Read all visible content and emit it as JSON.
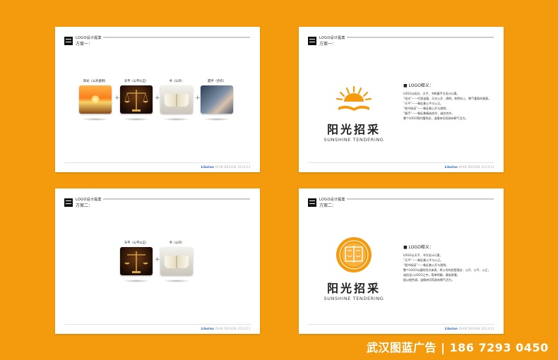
{
  "header": {
    "title": "LOGO设计提案",
    "scheme1": "方案一：",
    "scheme2": "方案二："
  },
  "footer": {
    "logo": "Libolan",
    "right_text": "DIAN DESIGN",
    "page": "2013/11"
  },
  "card1": {
    "items": [
      {
        "label": "阳光（公开透明）",
        "icon": "sunrise-image"
      },
      {
        "label": "天平（公平公正）",
        "icon": "scales-image"
      },
      {
        "label": "书（公开）",
        "icon": "open-book-image"
      },
      {
        "label": "握手（合作）",
        "icon": "handshake-image"
      }
    ],
    "plus": "+"
  },
  "card3": {
    "items": [
      {
        "label": "天平（公平公正）",
        "icon": "scales-image"
      },
      {
        "label": "书（公开）",
        "icon": "open-book-image"
      }
    ],
    "plus": "+"
  },
  "logo": {
    "cn": "阳光招采",
    "en": "SUNSHINE TENDERING"
  },
  "explain1": {
    "title": "■ LOGO释义：",
    "lines": [
      "LOGO以阳光、天平、书和握手为设计元素。",
      "“阳光”——代表温暖，天光公开、透明，和煦向上、朝气蓬勃的寓意。",
      "“天平”——象征着公平与公正。",
      "“图书阅读”——象征着公开与透明。",
      "“握手”——象征着精诚合作，诚信合作。",
      "整个LOGO简约醒色彩，温情亲切而具有朝气活力。"
    ]
  },
  "explain2": {
    "title": "■ LOGO释义：",
    "lines": [
      "LOGO以天平、书为设计元素。",
      "“天平”——象征着公平与公正。",
      "“图书阅读”——象征着公开与透明。",
      "整个LOGO以圆的形式来表，将公司的经营理念：公开、公平、公正，诚信深入LOGO之中。简单明确，通俗易懂。",
      "配以橙色调，温情亲切而具有朝气活力。"
    ]
  },
  "brand": "武汉图蓝广告 | 186 7293 0450",
  "colors": {
    "background": "#f39a0d",
    "logo_orange": "#f39a0d",
    "footer_blue": "#1b5eb5"
  }
}
